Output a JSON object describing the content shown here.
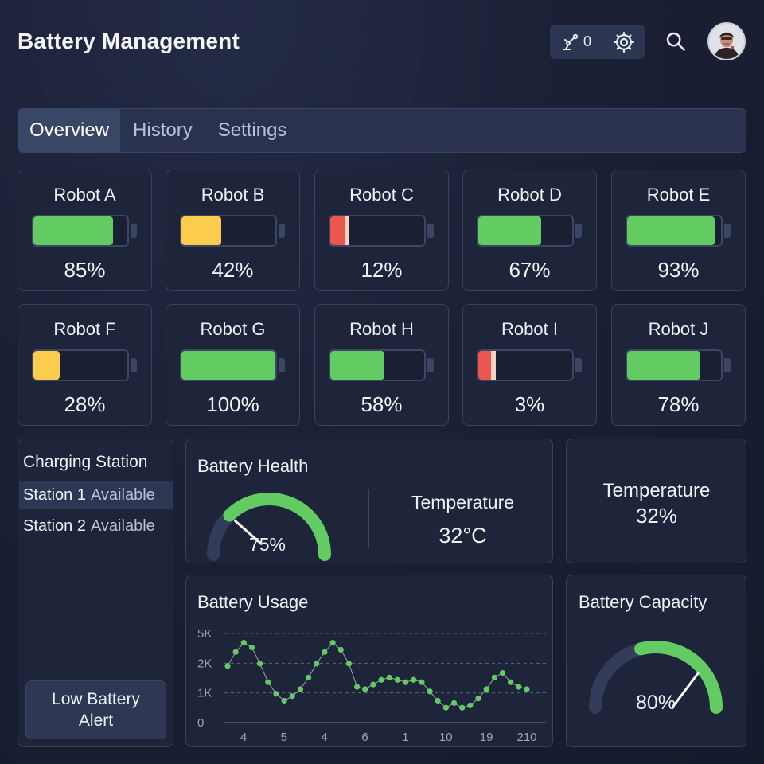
{
  "header": {
    "title": "Battery Management",
    "connections_count": "0",
    "icons": [
      "robot-arm-icon",
      "gear-icon",
      "search-icon",
      "avatar"
    ]
  },
  "tabs": [
    {
      "label": "Overview",
      "active": true
    },
    {
      "label": "History",
      "active": false
    },
    {
      "label": "Settings",
      "active": false
    }
  ],
  "colors": {
    "good": "#62cc63",
    "warn": "#fccc4f",
    "critical": "#ec5650",
    "track": "#39415c"
  },
  "robots": [
    {
      "name": "Robot A",
      "level": 0.85,
      "percent": "85%",
      "status": "good"
    },
    {
      "name": "Robot B",
      "level": 0.42,
      "percent": "42%",
      "status": "warn"
    },
    {
      "name": "Robot C",
      "level": 0.12,
      "percent": "12%",
      "status": "critical"
    },
    {
      "name": "Robot D",
      "level": 0.67,
      "percent": "67%",
      "status": "good"
    },
    {
      "name": "Robot E",
      "level": 0.93,
      "percent": "93%",
      "status": "good"
    },
    {
      "name": "Robot F",
      "level": 0.28,
      "percent": "28%",
      "status": "warn"
    },
    {
      "name": "Robot G",
      "level": 1.0,
      "percent": "100%",
      "status": "good"
    },
    {
      "name": "Robot H",
      "level": 0.58,
      "percent": "58%",
      "status": "good"
    },
    {
      "name": "Robot I",
      "level": 0.03,
      "percent": "3%",
      "status": "critical"
    },
    {
      "name": "Robot J",
      "level": 0.78,
      "percent": "78%",
      "status": "good"
    }
  ],
  "charging": {
    "title": "Charging Station",
    "stations": [
      {
        "name": "Station 1",
        "status": "Available",
        "selected": true
      },
      {
        "name": "Station 2",
        "status": "Available",
        "selected": false
      }
    ],
    "alert_button": "Low Battery Alert"
  },
  "health": {
    "title": "Battery Health",
    "value": 0.75,
    "label": "75%",
    "temperature_label": "Temperature",
    "temperature_value": "32°C"
  },
  "temperature_card": {
    "label": "Temperature",
    "value": "32%"
  },
  "usage": {
    "title": "Battery Usage",
    "chart_data": {
      "type": "scatter",
      "yticks": [
        "5K",
        "2K",
        "1K",
        "0"
      ],
      "xticks": [
        "4",
        "5",
        "4",
        "6",
        "1",
        "10",
        "19",
        "210"
      ],
      "grid": true,
      "series": [
        {
          "values": [
            2.1,
            2.7,
            3.1,
            2.9,
            2.2,
            1.4,
            0.9,
            0.6,
            0.8,
            1.1,
            1.6,
            2.2,
            2.7,
            3.1,
            2.8,
            2.2,
            1.2,
            1.1,
            1.3,
            1.5,
            1.6,
            1.5,
            1.4,
            1.5,
            1.4,
            1.0,
            0.6,
            0.3,
            0.5,
            0.3,
            0.4,
            0.7,
            1.1,
            1.6,
            1.8,
            1.4,
            1.2,
            1.1
          ]
        }
      ]
    }
  },
  "capacity": {
    "title": "Battery Capacity",
    "value": 0.8,
    "label": "80%"
  }
}
